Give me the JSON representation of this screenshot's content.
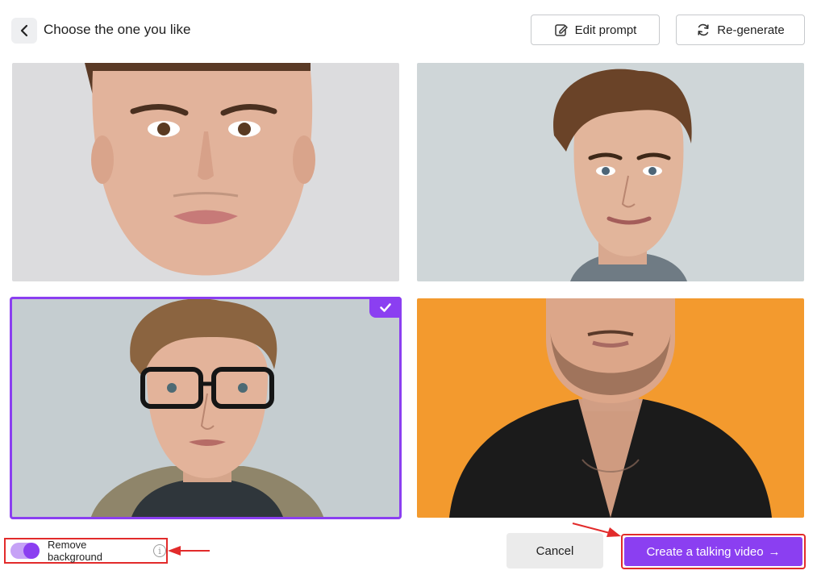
{
  "header": {
    "title": "Choose the one you like",
    "edit_prompt_label": "Edit prompt",
    "regenerate_label": "Re-generate"
  },
  "images": [
    {
      "id": "portrait-1",
      "selected": false,
      "background": "#d9dadc"
    },
    {
      "id": "portrait-2",
      "selected": false,
      "background": "#cfd6d8"
    },
    {
      "id": "portrait-3",
      "selected": true,
      "background": "#c5cdd0"
    },
    {
      "id": "portrait-4",
      "selected": false,
      "background": "#f39a2e"
    }
  ],
  "footer": {
    "remove_background_label": "Remove background",
    "remove_background_enabled": true,
    "info_glyph": "i",
    "cancel_label": "Cancel",
    "create_label": "Create a talking video",
    "create_arrow": "→"
  },
  "colors": {
    "accent": "#8b3ff1",
    "annotation_red": "#e22b2b"
  },
  "icons": [
    "chevron-left-icon",
    "edit-icon",
    "refresh-icon",
    "check-icon",
    "info-icon",
    "arrow-right-icon"
  ]
}
